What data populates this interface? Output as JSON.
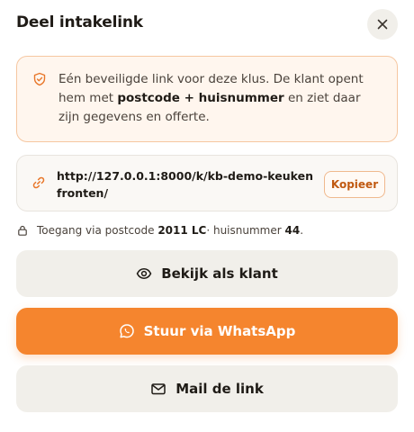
{
  "header": {
    "title": "Deel intakelink",
    "close_symbol": "✕"
  },
  "info": {
    "icon": "shield-check-icon",
    "text_1": "Eén beveiligde link voor deze klus. De klant opent hem met ",
    "bold": "postcode + huisnummer",
    "text_2": " en ziet daar zijn gegevens en offerte."
  },
  "link": {
    "icon": "link-icon",
    "url": "http://127.0.0.1:8000/k/kb-demo-keukenfronten/",
    "copy_label": "Kopieer"
  },
  "access": {
    "icon": "lock-icon",
    "prefix": "Toegang via postcode ",
    "postcode": "2011 LC",
    "middle": " · huisnummer ",
    "house_number": "44",
    "suffix": "."
  },
  "actions": {
    "view_label": "Bekijk als klant",
    "whatsapp_label": "Stuur via WhatsApp",
    "mail_label": "Mail de link"
  },
  "colors": {
    "accent": "#f5852e",
    "accent_text": "#c05a12",
    "info_bg": "#fff6ee",
    "info_border": "#f6c7a1",
    "secondary_bg": "#f1efea"
  }
}
